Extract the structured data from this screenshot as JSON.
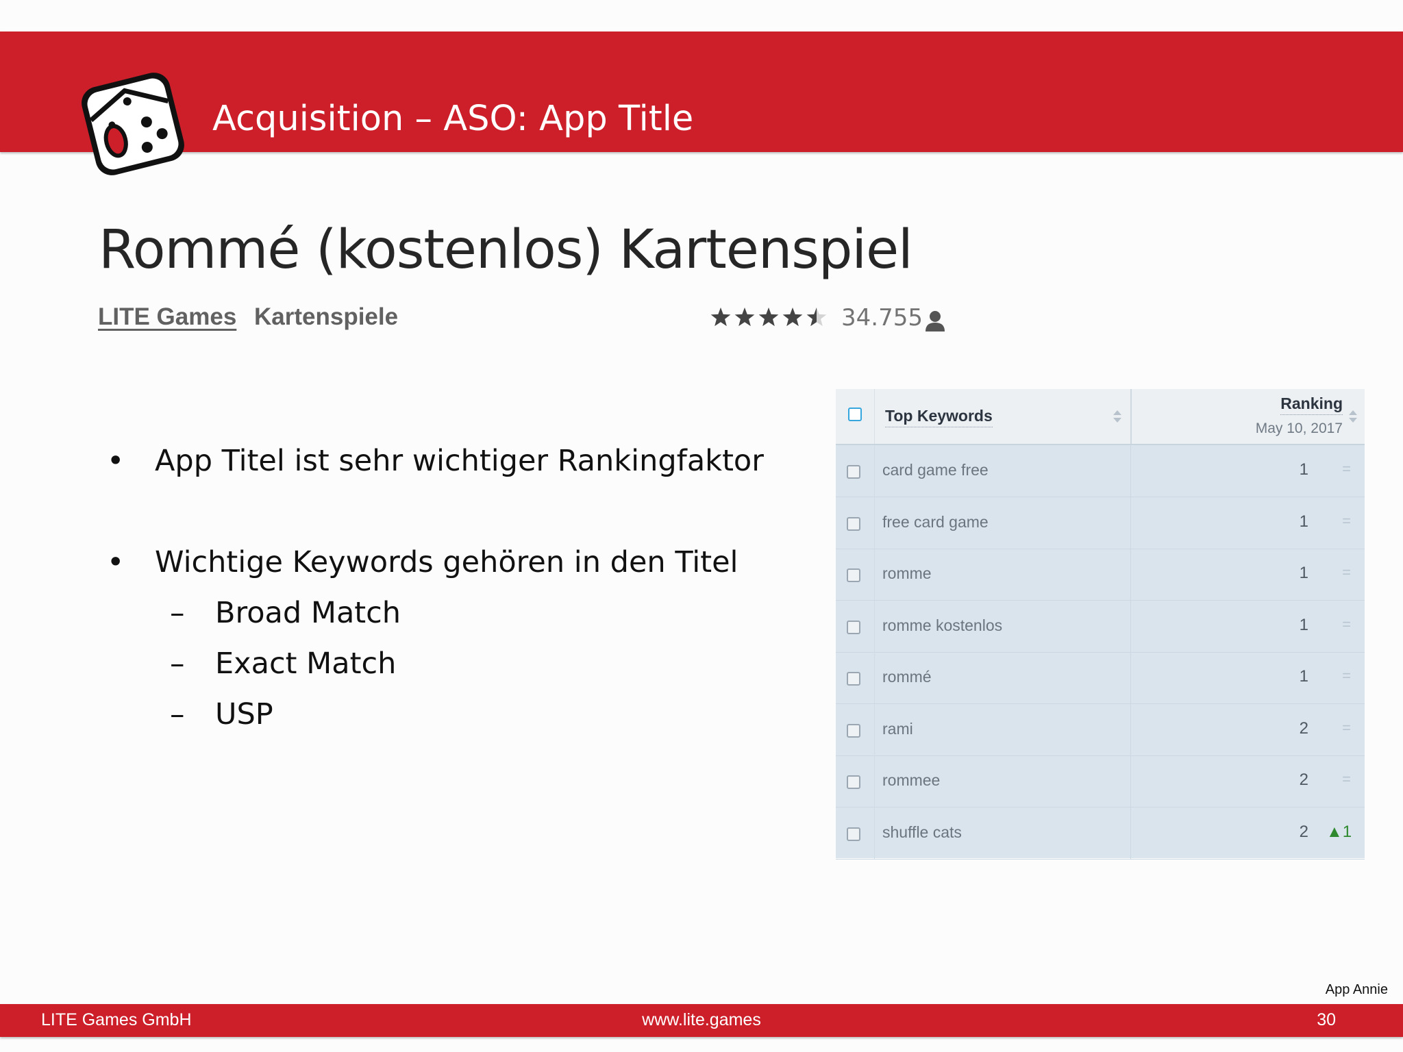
{
  "header": {
    "title": "Acquisition – ASO: App Title"
  },
  "app": {
    "name": "Rommé (kostenlos) Kartenspiel",
    "developer": "LITE Games",
    "category": "Kartenspiele",
    "rating_stars": 4.5,
    "rating_count": "34.755"
  },
  "bullets": [
    {
      "text": "App Titel ist sehr wichtiger Rankingfaktor"
    },
    {
      "text": "Wichtige Keywords gehören in den Titel"
    }
  ],
  "sub_bullets": [
    {
      "text": "Broad Match"
    },
    {
      "text": "Exact Match"
    },
    {
      "text": "USP"
    }
  ],
  "keyword_table": {
    "col_keywords": "Top Keywords",
    "col_ranking": "Ranking",
    "ranking_date": "May 10, 2017",
    "rows": [
      {
        "keyword": "card game free",
        "rank": "1",
        "change": "="
      },
      {
        "keyword": "free card game",
        "rank": "1",
        "change": "="
      },
      {
        "keyword": "romme",
        "rank": "1",
        "change": "="
      },
      {
        "keyword": "romme kostenlos",
        "rank": "1",
        "change": "="
      },
      {
        "keyword": "rommé",
        "rank": "1",
        "change": "="
      },
      {
        "keyword": "rami",
        "rank": "2",
        "change": "="
      },
      {
        "keyword": "rommee",
        "rank": "2",
        "change": "="
      },
      {
        "keyword": "shuffle cats",
        "rank": "2",
        "change": "▲1"
      }
    ]
  },
  "source": "App Annie",
  "footer": {
    "company": "LITE Games GmbH",
    "url": "www.lite.games",
    "page": "30"
  },
  "colors": {
    "brand_red": "#cd1f2a",
    "table_bg": "#d9e4ed",
    "rank_up_green": "#2f8a2f"
  }
}
